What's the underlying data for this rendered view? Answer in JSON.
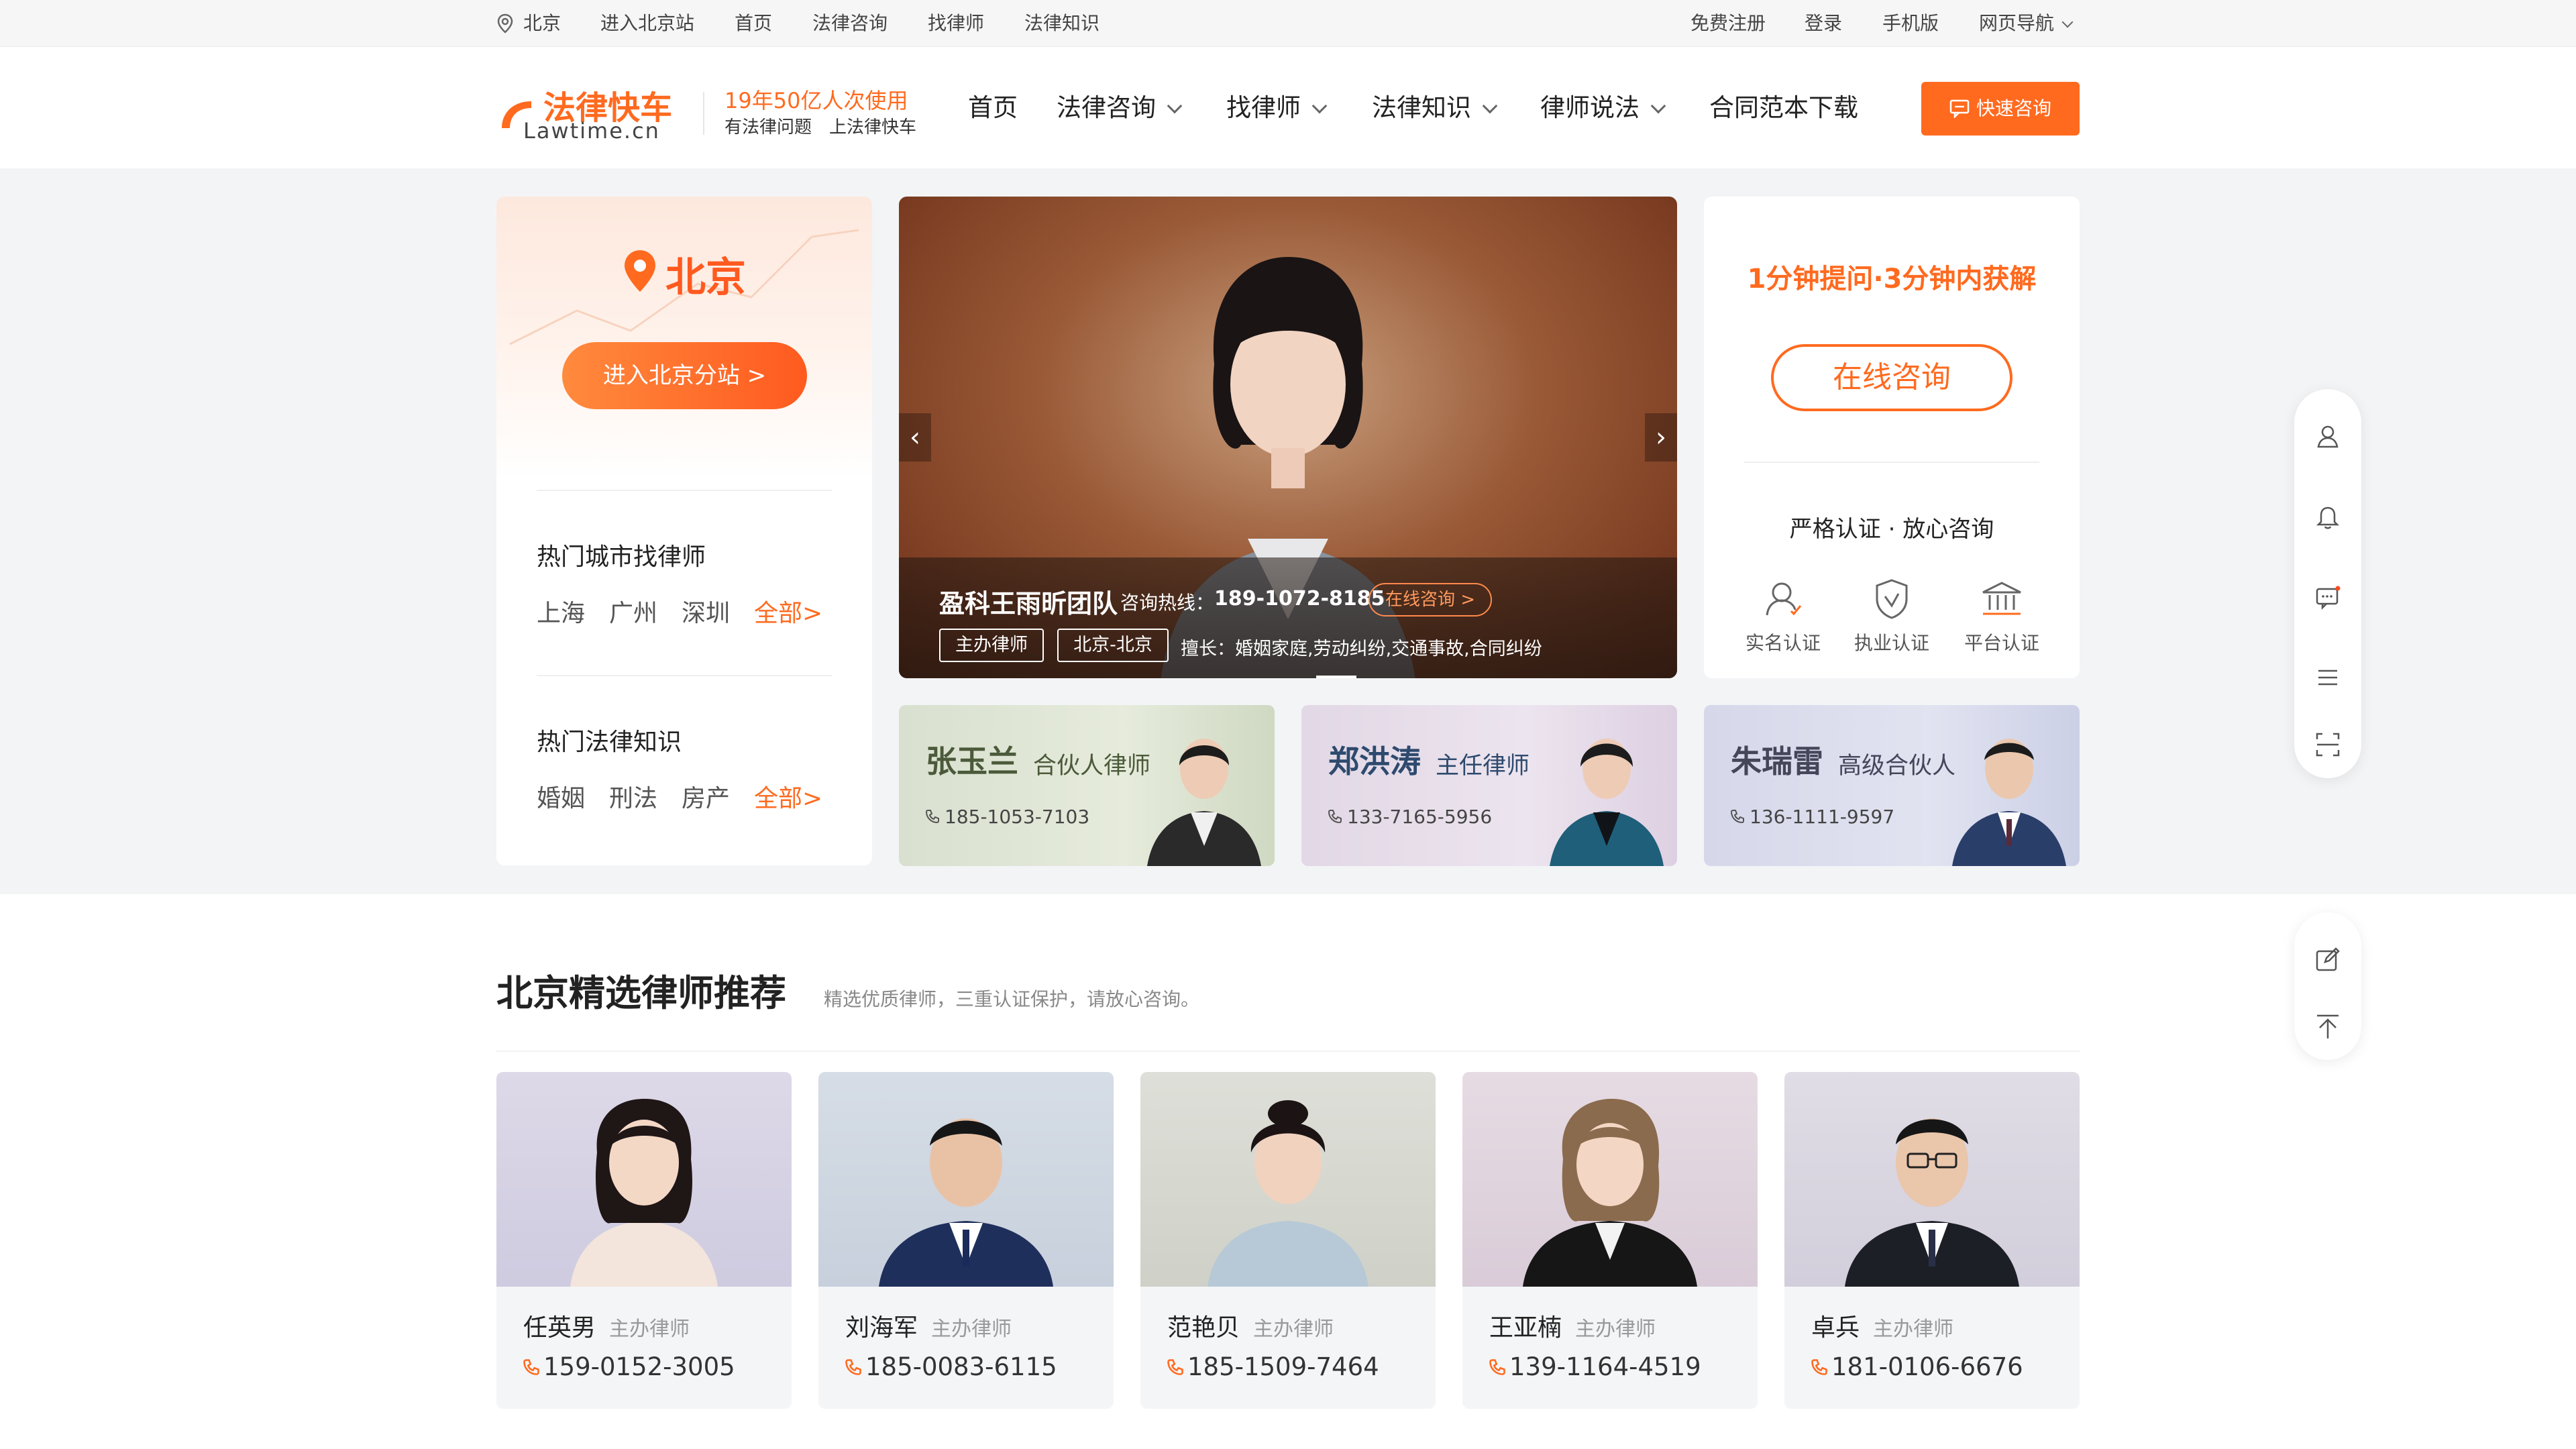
{
  "topbar": {
    "location": "北京",
    "links_left": [
      "进入北京站",
      "首页",
      "法律咨询",
      "找律师",
      "法律知识"
    ],
    "links_right": [
      "免费注册",
      "登录",
      "手机版",
      "网页导航"
    ]
  },
  "header": {
    "logo_cn": "法律快车",
    "logo_en": "Lawtime.cn",
    "slogan_top": "19年50亿人次使用",
    "slogan_bottom": "有法律问题　上法律快车",
    "nav": [
      "首页",
      "法律咨询",
      "找律师",
      "法律知识",
      "律师说法",
      "合同范本下载"
    ],
    "quick_button": "快速咨询"
  },
  "left_panel": {
    "city": "北京",
    "enter_button": "进入北京分站 >",
    "hot_city_title": "热门城市找律师",
    "hot_cities": [
      "上海",
      "广州",
      "深圳"
    ],
    "hot_city_all": "全部>",
    "hot_law_title": "热门法律知识",
    "hot_laws": [
      "婚姻",
      "刑法",
      "房产"
    ],
    "hot_law_all": "全部>"
  },
  "banner": {
    "team_name": "盈科王雨昕团队",
    "hotline_label": "咨询热线：",
    "hotline": "189-1072-8185",
    "consult_button": "在线咨询 >",
    "tag_role": "主办律师",
    "tag_city": "北京-北京",
    "specialties": "擅长：婚姻家庭,劳动纠纷,交通事故,合同纠纷",
    "prev": "‹",
    "next": "›"
  },
  "right_panel": {
    "headline": "1分钟提问·3分钟内获解",
    "consult_button": "在线咨询",
    "subtitle": "严格认证 · 放心咨询",
    "badges": [
      "实名认证",
      "执业认证",
      "平台认证"
    ]
  },
  "mini_lawyers": [
    {
      "name": "张玉兰",
      "title": "合伙人律师",
      "phone": "185-1053-7103"
    },
    {
      "name": "郑洪涛",
      "title": "主任律师",
      "phone": "133-7165-5956"
    },
    {
      "name": "朱瑞雷",
      "title": "高级合伙人",
      "phone": "136-1111-9597"
    }
  ],
  "recommend": {
    "title": "北京精选律师推荐",
    "subtitle": "精选优质律师，三重认证保护，请放心咨询。",
    "lawyers": [
      {
        "name": "任英男",
        "role": "主办律师",
        "phone": "159-0152-3005"
      },
      {
        "name": "刘海军",
        "role": "主办律师",
        "phone": "185-0083-6115"
      },
      {
        "name": "范艳贝",
        "role": "主办律师",
        "phone": "185-1509-7464"
      },
      {
        "name": "王亚楠",
        "role": "主办律师",
        "phone": "139-1164-4519"
      },
      {
        "name": "卓兵",
        "role": "主办律师",
        "phone": "181-0106-6676"
      }
    ]
  },
  "colors": {
    "accent": "#ff6a1f",
    "accent_dark": "#e8591a",
    "band_bg": "#f3f4f6"
  },
  "icons": [
    "location-icon",
    "chevron-down-icon",
    "chat-icon",
    "map-pin-icon",
    "user-icon",
    "shield-icon",
    "bank-icon",
    "phone-icon",
    "bell-icon",
    "message-icon",
    "menu-icon",
    "scan-icon",
    "edit-icon",
    "back-to-top-icon"
  ]
}
